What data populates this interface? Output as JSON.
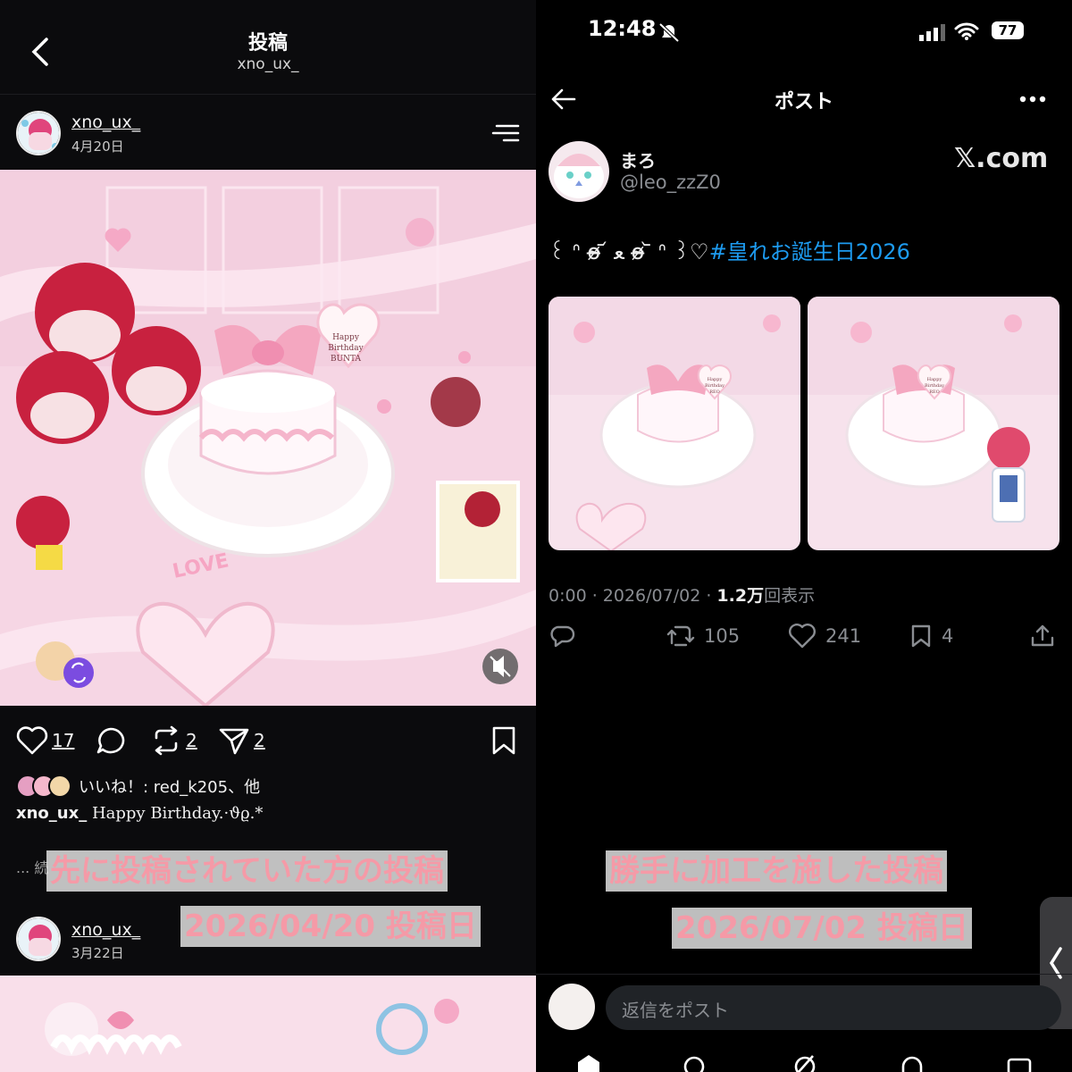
{
  "left_panel": {
    "header": {
      "title": "投稿",
      "subtitle": "xno_ux_"
    },
    "post1": {
      "username": "xno_ux_",
      "date": "4月20日",
      "cake_text": [
        "Happy",
        "Birthday",
        "BUNTA"
      ],
      "sticker_text": "LOVE",
      "actions": {
        "likes": "17",
        "reposts": "2",
        "shares": "2"
      },
      "liked_by": "いいね！: red_k205、他",
      "caption_user": "xno_ux_",
      "caption_text": "Happy Birthday.·ϑϱ.*",
      "more": "... 続"
    },
    "post2": {
      "username": "xno_ux_",
      "date": "3月22日"
    }
  },
  "right_panel": {
    "status_bar": {
      "time": "12:48",
      "battery": "77"
    },
    "header": {
      "title": "ポスト"
    },
    "author": {
      "name": "まろ",
      "handle": "@leo_zzZ0"
    },
    "watermark": "𝕏.com",
    "tweet": {
      "prefix": "꒰ ᐢ o̴̶̷ ᷄ ﻌ o̴̶̷ ᷅ ᐢ ꒱♡",
      "hashtag": "#皇れお誕生日2026"
    },
    "images": [
      {
        "cake_text": [
          "Happy",
          "Birthday",
          "REO"
        ]
      },
      {
        "cake_text": [
          "Happy",
          "Birthday",
          "REO"
        ]
      }
    ],
    "meta": {
      "time_date": "0:00 · 2026/07/02 · ",
      "views": "1.2万",
      "views_label": "回表示"
    },
    "actions": {
      "reposts": "105",
      "likes": "241",
      "bookmarks": "4"
    },
    "reply_placeholder": "返信をポスト"
  },
  "overlays": {
    "left_line1": "先に投稿されていた方の投稿",
    "left_line2": "2026/04/20 投稿日",
    "right_line1": "勝手に加工を施した投稿",
    "right_line2": "2026/07/02 投稿日"
  },
  "colors": {
    "overlay_text": "#f59aa7",
    "hashtag": "#1d9bf0",
    "pink_bg": "#f6d3e3"
  }
}
